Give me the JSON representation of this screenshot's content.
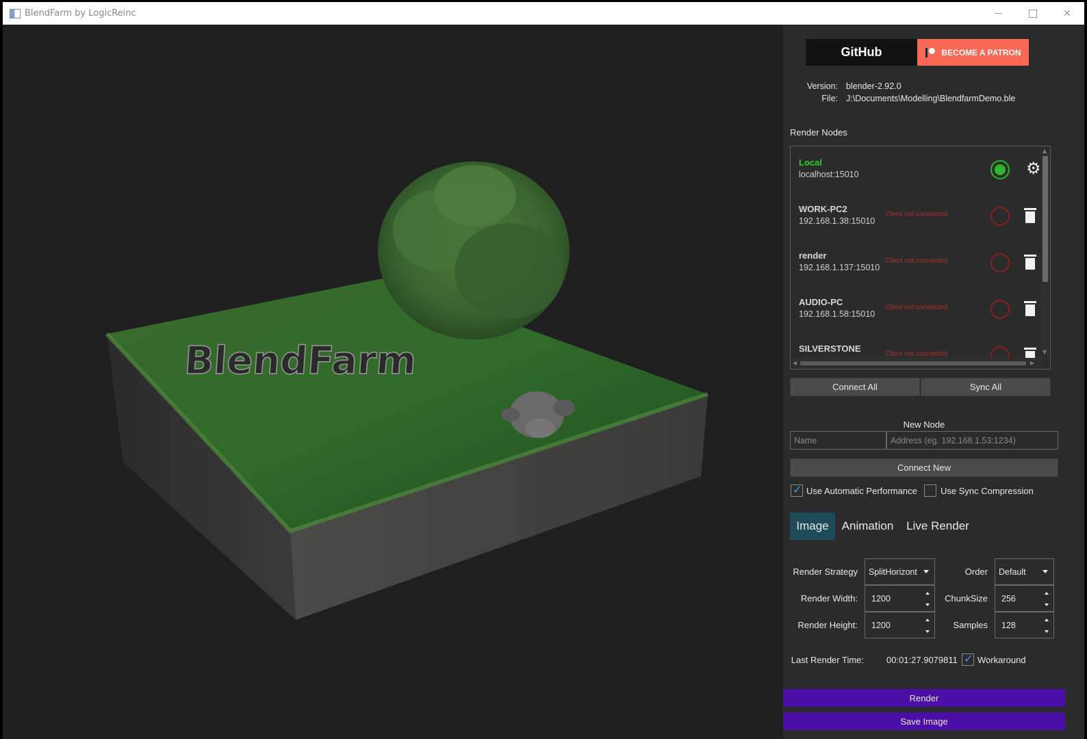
{
  "window": {
    "title": "BlendFarm by LogicReinc"
  },
  "links": {
    "github_label": "GitHub",
    "patron_label": "BECOME A PATRON"
  },
  "info": {
    "version_label": "Version:",
    "version_value": "blender-2.92.0",
    "file_label": "File:",
    "file_value": "J:\\Documents\\Modelling\\BlendfarmDemo.ble"
  },
  "render_nodes": {
    "title": "Render Nodes",
    "nodes": [
      {
        "name": "Local",
        "address": "localhost:15010",
        "status": "",
        "connected": true
      },
      {
        "name": "WORK-PC2",
        "address": "192.168.1.38:15010",
        "status": "Client not connected",
        "connected": false
      },
      {
        "name": "render",
        "address": "192.168.1.137:15010",
        "status": "Client not connected",
        "connected": false
      },
      {
        "name": "AUDIO-PC",
        "address": "192.168.1.58:15010",
        "status": "Client not connected",
        "connected": false
      },
      {
        "name": "SILVERSTONE",
        "address": "",
        "status": "Client not connected",
        "connected": false
      }
    ],
    "connect_all": "Connect All",
    "sync_all": "Sync All"
  },
  "new_node": {
    "title": "New Node",
    "name_placeholder": "Name",
    "address_placeholder": "Address (eg. 192.168.1.53:1234)",
    "connect_label": "Connect New"
  },
  "options": {
    "auto_perf_label": "Use Automatic Performance",
    "auto_perf_checked": true,
    "sync_compression_label": "Use Sync Compression",
    "sync_compression_checked": false
  },
  "tabs": [
    "Image",
    "Animation",
    "Live Render"
  ],
  "active_tab": "Image",
  "settings": {
    "strategy_label": "Render Strategy",
    "strategy_value": "SplitHorizont",
    "order_label": "Order",
    "order_value": "Default",
    "width_label": "Render Width:",
    "width_value": "1200",
    "chunk_label": "ChunkSize",
    "chunk_value": "256",
    "height_label": "Render Height:",
    "height_value": "1200",
    "samples_label": "Samples",
    "samples_value": "128",
    "last_time_label": "Last Render Time:",
    "last_time_value": "00:01:27.9079811",
    "workaround_label": "Workaround",
    "workaround_checked": true
  },
  "actions": {
    "render_label": "Render",
    "save_label": "Save Image"
  },
  "scene": {
    "text": "BlendFarm"
  },
  "colors": {
    "accent": "#4b0ea6",
    "local_green": "#2ecc2e",
    "tab_active": "#1d4b5a",
    "error_red": "#8a1f1f"
  }
}
